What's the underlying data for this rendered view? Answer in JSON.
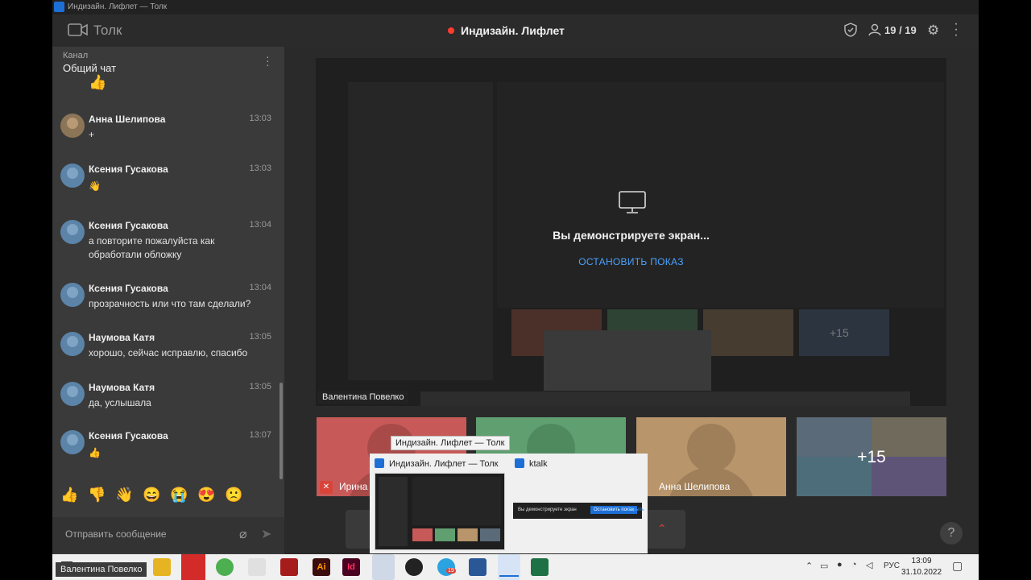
{
  "window": {
    "title": "Индизайн. Лифлет — Толк"
  },
  "header": {
    "app_name": "Толк",
    "conference_title": "Индизайн. Лифлет",
    "participants": "19 / 19",
    "icons": [
      "camera-icon",
      "shield-icon",
      "participants-icon",
      "gear-icon",
      "kebab-icon"
    ]
  },
  "chat": {
    "channel_label": "Канал",
    "channel_name": "Общий чат",
    "messages": [
      {
        "author": "Анна Шелипова",
        "time": "13:03",
        "text": "+"
      },
      {
        "author": "Ксения Гусакова",
        "time": "13:03",
        "text": "👋"
      },
      {
        "author": "Ксения Гусакова",
        "time": "13:04",
        "text": "а повторите пожалуйста как обработали обложку"
      },
      {
        "author": "Ксения Гусакова",
        "time": "13:04",
        "text": "прозрачность или что там сделали?"
      },
      {
        "author": "Наумова Катя",
        "time": "13:05",
        "text": "хорошо, сейчас исправлю, спасибо"
      },
      {
        "author": "Наумова Катя",
        "time": "13:05",
        "text": "да, услышала"
      },
      {
        "author": "Ксения Гусакова",
        "time": "13:07",
        "text": "👍"
      }
    ],
    "top_emoji": "👍",
    "reactions": [
      "👍",
      "👎",
      "👋",
      "😄",
      "😭",
      "😍",
      "🙁"
    ],
    "composer_placeholder": "Отправить сообщение"
  },
  "stage": {
    "share_message": "Вы демонстрируете экран...",
    "stop_button": "ОСТАНОВИТЬ ПОКАЗ",
    "presenter_name": "Валентина Повелко",
    "tiles": [
      {
        "name": "Ирина",
        "color": "#c75a58"
      },
      {
        "name": "",
        "color": "#5f9f70"
      },
      {
        "name": "Анна Шелипова",
        "color": "#b8956b"
      }
    ],
    "more_count": "+15",
    "ghost_more": "+15"
  },
  "taskbar_preview": {
    "tooltip": "Индизайн. Лифлет — Толк",
    "item1_title": "Индизайн. Лифлет — Толк",
    "item2_title": "ktalk",
    "mini_text": "Вы демонстрируете экран",
    "mini_button": "Остановить показ",
    "mini_link": "Скрыть"
  },
  "taskbar": {
    "user_tooltip": "Валентина Повелко",
    "language": "РУС",
    "time": "13:09",
    "date": "31.10.2022",
    "badge": "19"
  }
}
